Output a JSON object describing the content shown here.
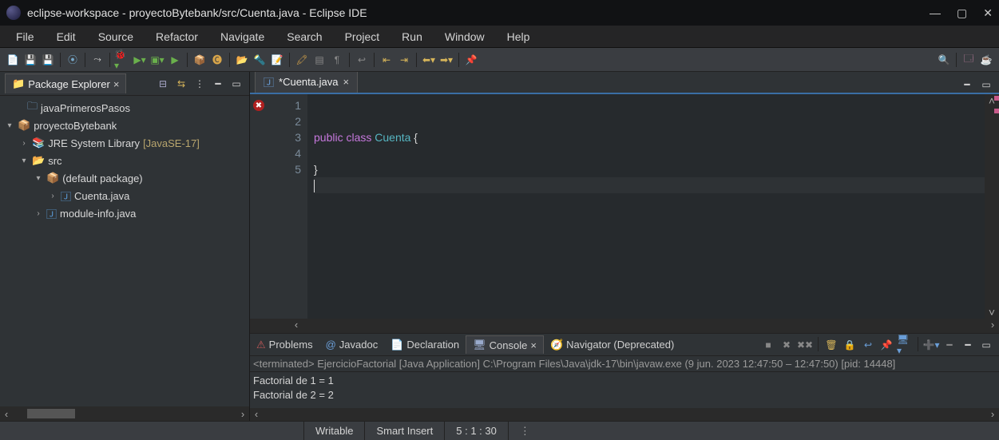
{
  "title": "eclipse-workspace - proyectoBytebank/src/Cuenta.java - Eclipse IDE",
  "menu": [
    "File",
    "Edit",
    "Source",
    "Refactor",
    "Navigate",
    "Search",
    "Project",
    "Run",
    "Window",
    "Help"
  ],
  "package_explorer": {
    "title": "Package Explorer",
    "tree": {
      "p1": "javaPrimerosPasos",
      "p2": "proyectoBytebank",
      "lib": "JRE System Library",
      "lib_env": "[JavaSE-17]",
      "src": "src",
      "defpkg": "(default package)",
      "file1": "Cuenta.java",
      "file2": "module-info.java"
    }
  },
  "editor": {
    "tab": "*Cuenta.java",
    "lines": {
      "l1": "1",
      "l2": "2",
      "l3": "3",
      "l4": "4",
      "l5": "5"
    },
    "code": {
      "l2_kw": "public class ",
      "l2_cls": "Cuenta",
      "l2_br": " {",
      "l4": "}"
    }
  },
  "bottom_panel": {
    "tabs": {
      "problems": "Problems",
      "javadoc": "Javadoc",
      "declaration": "Declaration",
      "console": "Console",
      "navigator": "Navigator (Deprecated)"
    },
    "console_header": "<terminated> EjercicioFactorial [Java Application] C:\\Program Files\\Java\\jdk-17\\bin\\javaw.exe  (9 jun. 2023 12:47:50 – 12:47:50) [pid: 14448]",
    "console_out": {
      "l1": "Factorial de 1 = 1",
      "l2": "Factorial de 2 = 2"
    }
  },
  "status": {
    "writable": "Writable",
    "insert": "Smart Insert",
    "pos": "5 : 1 : 30"
  }
}
